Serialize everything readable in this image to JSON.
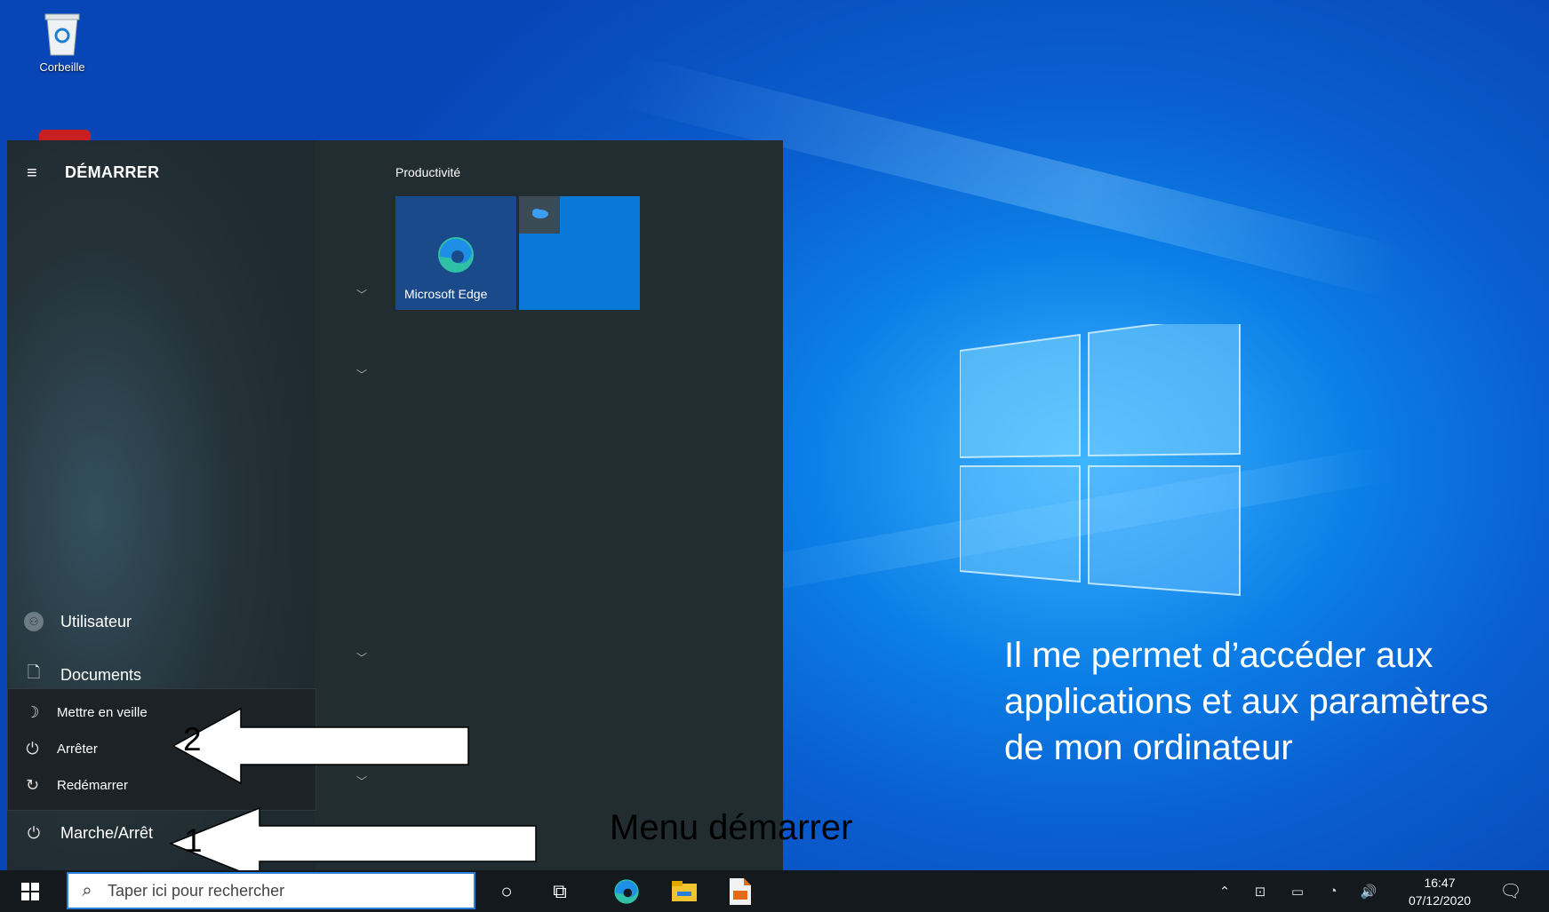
{
  "desktop": {
    "recycle_bin_label": "Corbeille"
  },
  "start_menu": {
    "title": "DÉMARRER",
    "section_label": "Productivité",
    "tiles": [
      {
        "label": "Microsoft Edge",
        "icon": "edge-icon"
      },
      {
        "label": "",
        "icon": "onedrive-icon"
      }
    ],
    "left_items": [
      {
        "label": "Utilisateur",
        "icon": "user-avatar-icon"
      },
      {
        "label": "Documents",
        "icon": "document-icon"
      },
      {
        "label": "Marche/Arrêt",
        "icon": "power-icon"
      }
    ],
    "power_menu": [
      {
        "label": "Mettre en veille",
        "icon": "moon-icon"
      },
      {
        "label": "Arrêter",
        "icon": "power-icon"
      },
      {
        "label": "Redémarrer",
        "icon": "restart-icon"
      }
    ]
  },
  "annotations": {
    "num1": "1",
    "num2": "2",
    "caption": "Menu démarrer",
    "description": "Il me permet d’accéder aux applications et aux paramètres de mon ordinateur"
  },
  "taskbar": {
    "search_placeholder": "Taper ici pour rechercher",
    "time": "16:47",
    "date": "07/12/2020"
  },
  "colors": {
    "taskbar": "#13191c",
    "start_bg": "#1f2a30",
    "accent": "#0a78d7"
  }
}
